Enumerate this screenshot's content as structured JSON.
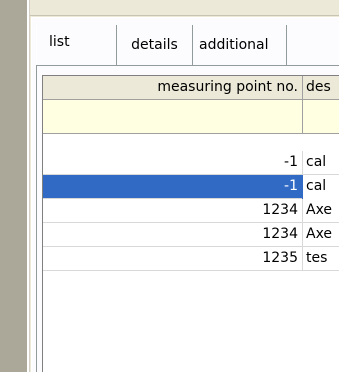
{
  "tabs": [
    {
      "label": "list"
    },
    {
      "label": "details"
    },
    {
      "label": "additional"
    }
  ],
  "grid": {
    "columns": [
      {
        "label": "measuring point no."
      },
      {
        "label": "des"
      }
    ],
    "rows": [
      {
        "measuring_point_no": "-1",
        "description": "cal",
        "selected": false
      },
      {
        "measuring_point_no": "-1",
        "description": "cal",
        "selected": true
      },
      {
        "measuring_point_no": "1234",
        "description": "Axe",
        "selected": false
      },
      {
        "measuring_point_no": "1234",
        "description": "Axe",
        "selected": false
      },
      {
        "measuring_point_no": "1235",
        "description": "tes",
        "selected": false
      }
    ]
  },
  "colors": {
    "selection": "#316ac5",
    "filter_row": "#ffffe1",
    "header": "#ece9d8"
  }
}
